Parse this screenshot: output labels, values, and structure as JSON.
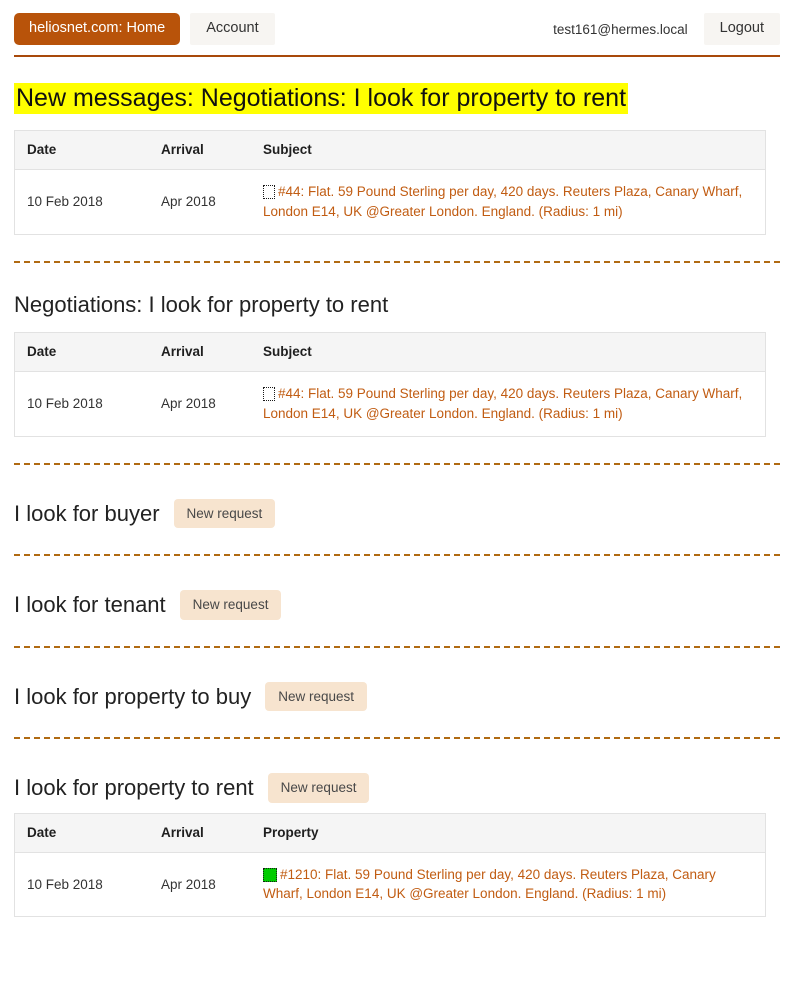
{
  "nav": {
    "brand_label": "heliosnet.com: Home",
    "account_label": "Account",
    "user_email": "test161@hermes.local",
    "logout_label": "Logout",
    "brand_color": "#b8530a",
    "rule_color": "#a8490a"
  },
  "new_messages": {
    "heading": "New messages: Negotiations: I look for property to rent",
    "highlight_color": "#ffff00",
    "table": {
      "columns": [
        "Date",
        "Arrival",
        "Subject"
      ],
      "rows": [
        {
          "date": "10 Feb 2018",
          "arrival": "Apr 2018",
          "marker": "empty-square-icon",
          "subject": "#44: Flat. 59 Pound Sterling per day, 420 days. Reuters Plaza, Canary Wharf, London E14, UK @Greater London. England. (Radius:  1 mi)"
        }
      ]
    }
  },
  "negotiations": {
    "heading": "Negotiations: I look for property to rent",
    "table": {
      "columns": [
        "Date",
        "Arrival",
        "Subject"
      ],
      "rows": [
        {
          "date": "10 Feb 2018",
          "arrival": "Apr 2018",
          "marker": "empty-square-icon",
          "subject": "#44: Flat. 59 Pound Sterling per day, 420 days. Reuters Plaza, Canary Wharf, London E14, UK @Greater London. England. (Radius:  1 mi)"
        }
      ]
    }
  },
  "look_for_buyer": {
    "heading": "I look for buyer",
    "new_request_label": "New request"
  },
  "look_for_tenant": {
    "heading": "I look for tenant",
    "new_request_label": "New request"
  },
  "look_for_property_to_buy": {
    "heading": "I look for property to buy",
    "new_request_label": "New request"
  },
  "look_for_property_to_rent": {
    "heading": "I look for property to rent",
    "new_request_label": "New request",
    "table": {
      "columns": [
        "Date",
        "Arrival",
        "Property"
      ],
      "rows": [
        {
          "date": "10 Feb 2018",
          "arrival": "Apr 2018",
          "marker": "green-square-icon",
          "marker_color": "#00cc00",
          "subject": "#1210: Flat. 59 Pound Sterling per day, 420 days. Reuters Plaza, Canary Wharf, London E14, UK @Greater London. England. (Radius:  1 mi)"
        }
      ]
    }
  },
  "theme": {
    "link_color": "#c15c12",
    "button_bg": "#f7e4cf",
    "divider_color": "#b06a12",
    "table_header_bg": "#f5f5f5"
  }
}
